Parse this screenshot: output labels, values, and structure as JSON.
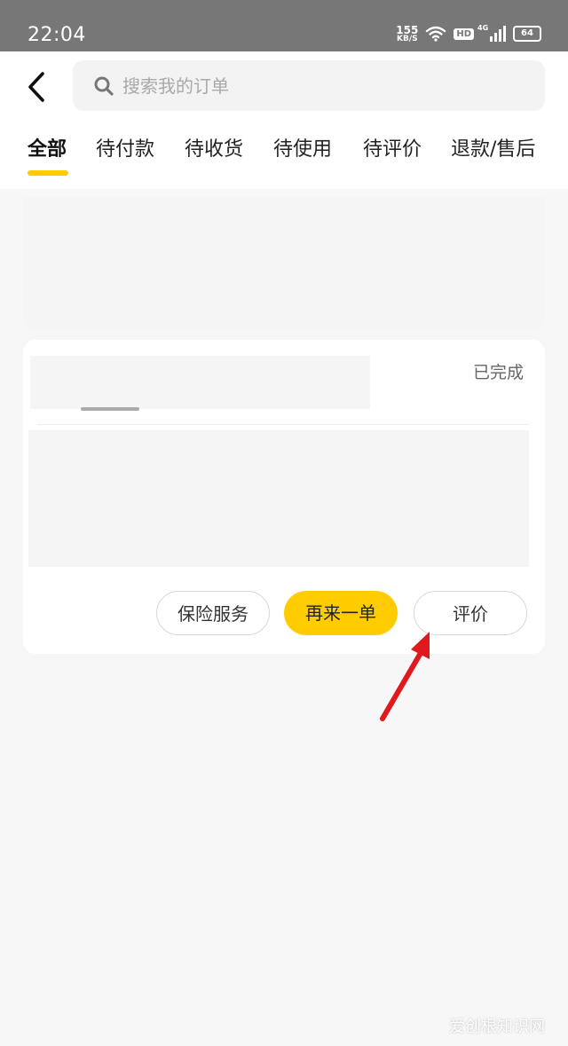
{
  "status_bar": {
    "time": "22:04",
    "net_speed_value": "155",
    "net_speed_unit": "KB/S",
    "hd_label": "HD",
    "signal_label": "4G",
    "battery": "64"
  },
  "header": {
    "search_placeholder": "搜索我的订单",
    "tabs": [
      "全部",
      "待付款",
      "待收货",
      "待使用",
      "待评价",
      "退款/售后"
    ],
    "active_tab_index": 0,
    "accent_color": "#ffcc00"
  },
  "order": {
    "status": "已完成",
    "buttons": {
      "insurance": "保险服务",
      "reorder": "再来一单",
      "review": "评价"
    }
  },
  "watermark": "爱创根知识网",
  "annotation": {
    "arrow_color": "#e0191e",
    "icon": "red-arrow-icon"
  }
}
